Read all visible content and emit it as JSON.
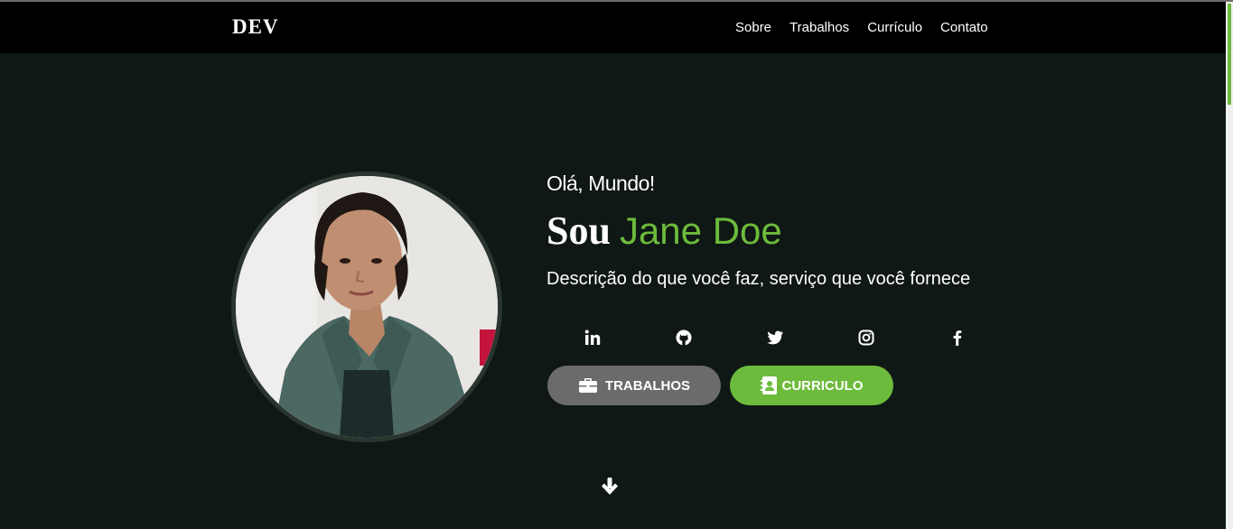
{
  "nav": {
    "brand": "DEV",
    "links": [
      "Sobre",
      "Trabalhos",
      "Currículo",
      "Contato"
    ]
  },
  "hero": {
    "greeting": "Olá, Mundo!",
    "sou": "Sou",
    "name": "Jane Doe",
    "description": "Descrição do que você faz, serviço que você fornece",
    "socials": [
      "linkedin-icon",
      "github-icon",
      "twitter-icon",
      "instagram-icon",
      "facebook-icon"
    ],
    "buttons": {
      "trabalhos": "TRABALHOS",
      "curriculo": "CURRICULO"
    }
  },
  "colors": {
    "background": "#0f1815",
    "navbar": "#000000",
    "accent": "#6dbb3c",
    "secondary_button": "#6b6b6b"
  }
}
